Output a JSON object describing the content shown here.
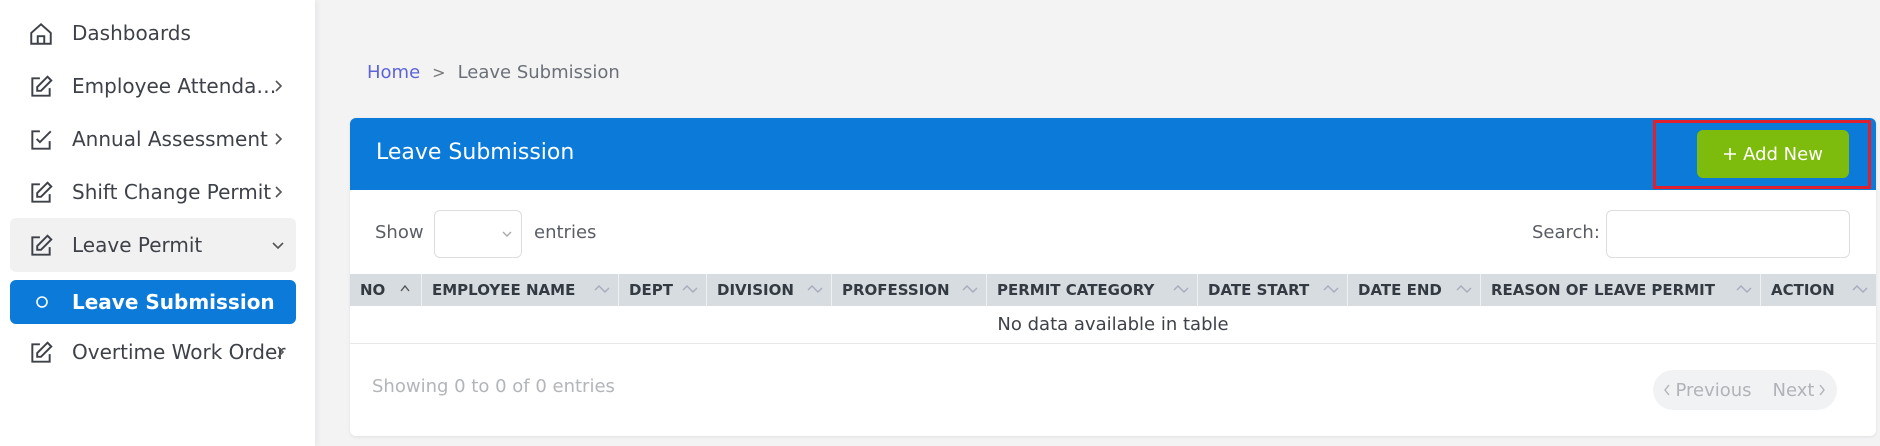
{
  "sidebar": {
    "items": [
      {
        "label": "Dashboards",
        "icon": "home-icon"
      },
      {
        "label": "Employee Attendan...",
        "icon": "edit-icon"
      },
      {
        "label": "Annual Assessment",
        "icon": "checkbox-edit-icon"
      },
      {
        "label": "Shift Change Permit",
        "icon": "edit-icon"
      },
      {
        "label": "Leave Permit",
        "icon": "edit-icon"
      },
      {
        "label": "Leave Submission",
        "icon": "circle-icon"
      },
      {
        "label": "Overtime Work Order",
        "icon": "edit-icon"
      }
    ]
  },
  "breadcrumb": {
    "home": "Home",
    "separator": ">",
    "current": "Leave Submission"
  },
  "card": {
    "title": "Leave Submission",
    "add_button": "Add New",
    "show_label": "Show",
    "show_value": "",
    "entries_label": "entries",
    "search_label": "Search:",
    "search_value": ""
  },
  "table": {
    "columns": [
      "NO",
      "EMPLOYEE NAME",
      "DEPT",
      "DIVISION",
      "PROFESSION",
      "PERMIT CATEGORY",
      "DATE START",
      "DATE END",
      "REASON OF LEAVE PERMIT",
      "ACTION"
    ],
    "empty_message": "No data available in table"
  },
  "footer": {
    "info": "Showing 0 to 0 of 0 entries",
    "previous": "Previous",
    "next": "Next"
  },
  "colors": {
    "primary": "#0b7ad8",
    "add_button": "#7dbb0d",
    "highlight_border": "#e0202e",
    "breadcrumb_link": "#5d64d6"
  }
}
